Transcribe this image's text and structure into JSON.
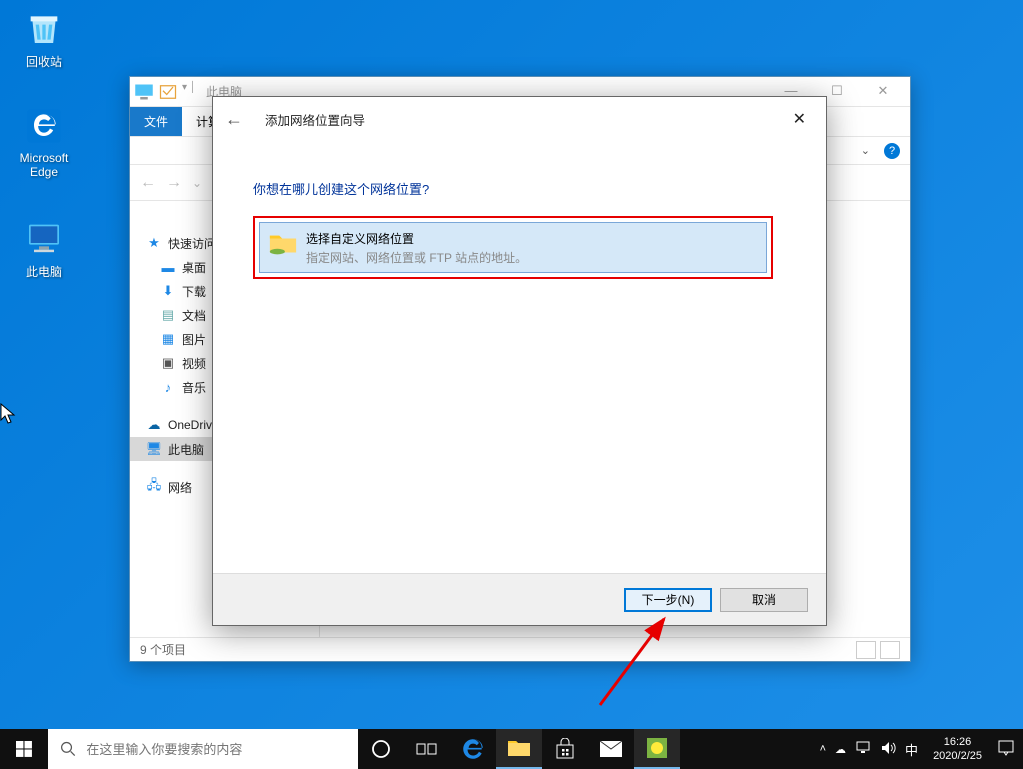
{
  "desktop": {
    "icons": [
      {
        "label": "回收站",
        "icon": "recycle"
      },
      {
        "label": "Microsoft Edge",
        "icon": "edge"
      },
      {
        "label": "此电脑",
        "icon": "pc"
      }
    ]
  },
  "explorer": {
    "title": "此电脑",
    "ribbon": {
      "file": "文件",
      "computer": "计算"
    },
    "sidebar": [
      {
        "label": "快速访问",
        "icon": "star",
        "cls": "first"
      },
      {
        "label": "桌面",
        "icon": "desk"
      },
      {
        "label": "下载",
        "icon": "down"
      },
      {
        "label": "文档",
        "icon": "doc"
      },
      {
        "label": "图片",
        "icon": "pic"
      },
      {
        "label": "视频",
        "icon": "vid"
      },
      {
        "label": "音乐",
        "icon": "music"
      },
      {
        "label": "OneDrive",
        "icon": "onedrive",
        "cls": "onedrive"
      },
      {
        "label": "此电脑",
        "icon": "pc",
        "cls": "sel"
      },
      {
        "label": "网络",
        "icon": "net",
        "cls": "network"
      }
    ],
    "status": "9 个项目"
  },
  "wizard": {
    "title": "添加网络位置向导",
    "question": "你想在哪儿创建这个网络位置?",
    "option": {
      "title": "选择自定义网络位置",
      "desc": "指定网站、网络位置或 FTP 站点的地址。"
    },
    "next": "下一步(N)",
    "cancel": "取消"
  },
  "taskbar": {
    "search_placeholder": "在这里输入你要搜索的内容",
    "ime": "中",
    "time": "16:26",
    "date": "2020/2/25"
  }
}
